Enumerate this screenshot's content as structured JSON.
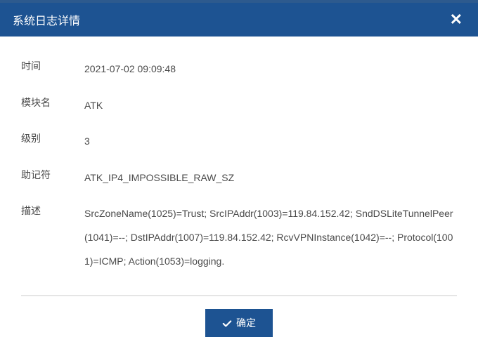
{
  "dialog": {
    "title": "系统日志详情"
  },
  "fields": {
    "time": {
      "label": "时间",
      "value": "2021-07-02 09:09:48"
    },
    "module": {
      "label": "模块名",
      "value": "ATK"
    },
    "level": {
      "label": "级别",
      "value": "3"
    },
    "mnemonic": {
      "label": "助记符",
      "value": "ATK_IP4_IMPOSSIBLE_RAW_SZ"
    },
    "description": {
      "label": "描述",
      "value": "SrcZoneName(1025)=Trust; SrcIPAddr(1003)=119.84.152.42; SndDSLiteTunnelPeer(1041)=--; DstIPAddr(1007)=119.84.152.42; RcvVPNInstance(1042)=--; Protocol(1001)=ICMP; Action(1053)=logging."
    }
  },
  "footer": {
    "confirm_label": "确定"
  }
}
